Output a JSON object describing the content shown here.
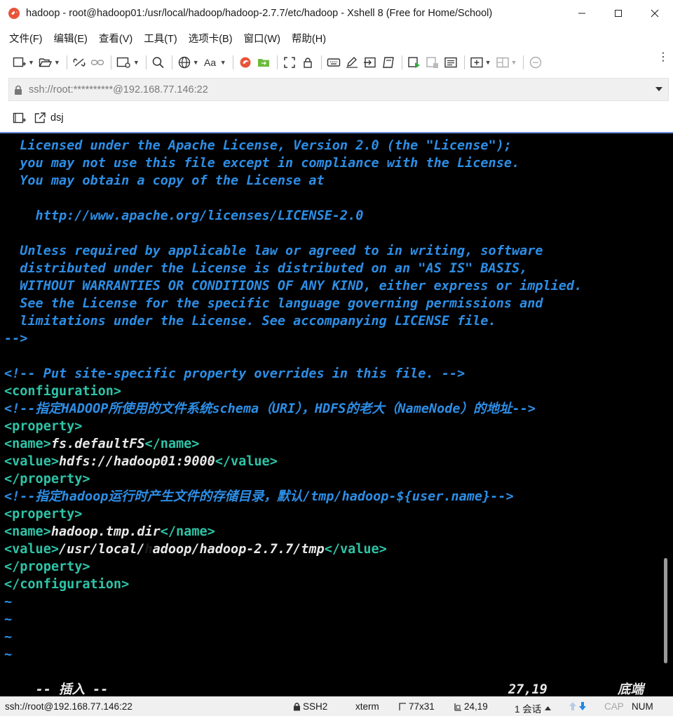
{
  "window": {
    "title": "hadoop - root@hadoop01:/usr/local/hadoop/hadoop-2.7.7/etc/hadoop - Xshell 8 (Free for Home/School)"
  },
  "menu": [
    "文件(F)",
    "编辑(E)",
    "查看(V)",
    "工具(T)",
    "选项卡(B)",
    "窗口(W)",
    "帮助(H)"
  ],
  "address": {
    "value": "ssh://root:**********@192.168.77.146:22"
  },
  "tab": {
    "label": "dsj"
  },
  "terminal": {
    "lines": [
      {
        "parts": [
          {
            "t": "  Licensed under the Apache License, Version 2.0 (the \"License\");",
            "c": "comment"
          }
        ]
      },
      {
        "parts": [
          {
            "t": "  you may not use this file except in compliance with the License.",
            "c": "comment"
          }
        ]
      },
      {
        "parts": [
          {
            "t": "  You may obtain a copy of the License at",
            "c": "comment"
          }
        ]
      },
      {
        "parts": [
          {
            "t": "",
            "c": "comment"
          }
        ]
      },
      {
        "parts": [
          {
            "t": "    http://www.apache.org/licenses/LICENSE-2.0",
            "c": "comment"
          }
        ]
      },
      {
        "parts": [
          {
            "t": "",
            "c": "comment"
          }
        ]
      },
      {
        "parts": [
          {
            "t": "  Unless required by applicable law or agreed to in writing, software",
            "c": "comment"
          }
        ]
      },
      {
        "parts": [
          {
            "t": "  distributed under the License is distributed on an \"AS IS\" BASIS,",
            "c": "comment"
          }
        ]
      },
      {
        "parts": [
          {
            "t": "  WITHOUT WARRANTIES OR CONDITIONS OF ANY KIND, either express or implied.",
            "c": "comment"
          }
        ]
      },
      {
        "parts": [
          {
            "t": "  See the License for the specific language governing permissions and",
            "c": "comment"
          }
        ]
      },
      {
        "parts": [
          {
            "t": "  limitations under the License. See accompanying LICENSE file.",
            "c": "comment"
          }
        ]
      },
      {
        "parts": [
          {
            "t": "-->",
            "c": "comment"
          }
        ]
      },
      {
        "parts": [
          {
            "t": "",
            "c": "comment"
          }
        ]
      },
      {
        "parts": [
          {
            "t": "<!-- Put site-specific property overrides in this file. -->",
            "c": "comment"
          }
        ]
      },
      {
        "parts": [
          {
            "t": "<configuration>",
            "c": "tag"
          }
        ]
      },
      {
        "parts": [
          {
            "t": "<!--指定HADOOP所使用的文件系统schema（URI），HDFS的老大（NameNode）的地址-->",
            "c": "comment"
          }
        ]
      },
      {
        "parts": [
          {
            "t": "<property>",
            "c": "tag"
          }
        ]
      },
      {
        "parts": [
          {
            "t": "<name>",
            "c": "tag"
          },
          {
            "t": "fs.defaultFS",
            "c": "text"
          },
          {
            "t": "</name>",
            "c": "tag"
          }
        ]
      },
      {
        "parts": [
          {
            "t": "<value>",
            "c": "tag"
          },
          {
            "t": "hdfs://hadoop01:9000",
            "c": "text"
          },
          {
            "t": "</value>",
            "c": "tag"
          }
        ]
      },
      {
        "parts": [
          {
            "t": "</property>",
            "c": "tag"
          }
        ]
      },
      {
        "parts": [
          {
            "t": "<!--指定hadoop运行时产生文件的存储目录，默认/tmp/hadoop-${user.name}-->",
            "c": "comment"
          }
        ]
      },
      {
        "parts": [
          {
            "t": "<property>",
            "c": "tag"
          }
        ]
      },
      {
        "parts": [
          {
            "t": "<name>",
            "c": "tag"
          },
          {
            "t": "hadoop.tmp.dir",
            "c": "text"
          },
          {
            "t": "</name>",
            "c": "tag"
          }
        ]
      },
      {
        "parts": [
          {
            "t": "<value>",
            "c": "tag"
          },
          {
            "t": "/usr/local/",
            "c": "text"
          },
          {
            "t": "h",
            "c": "cursor"
          },
          {
            "t": "adoop/hadoop-2.7.7/tmp",
            "c": "text"
          },
          {
            "t": "</value>",
            "c": "tag"
          }
        ]
      },
      {
        "parts": [
          {
            "t": "</property>",
            "c": "tag"
          }
        ]
      },
      {
        "parts": [
          {
            "t": "</configuration>",
            "c": "tag"
          }
        ]
      },
      {
        "parts": [
          {
            "t": "~",
            "c": "tilde"
          }
        ]
      },
      {
        "parts": [
          {
            "t": "~",
            "c": "tilde"
          }
        ]
      },
      {
        "parts": [
          {
            "t": "~",
            "c": "tilde"
          }
        ]
      },
      {
        "parts": [
          {
            "t": "~",
            "c": "tilde"
          }
        ]
      }
    ],
    "mode": "-- 插入 --",
    "position": "27,19",
    "scroll_label": "底端"
  },
  "statusbar": {
    "connection": "ssh://root@192.168.77.146:22",
    "protocol": "SSH2",
    "term": "xterm",
    "size": "77x31",
    "cursor": "24,19",
    "sessions": "1 会话",
    "cap": "CAP",
    "num": "NUM"
  },
  "colors": {
    "comment": "#2d8ee6",
    "tag": "#2ec4a8",
    "text": "#e8e8e8",
    "cursor": "#35e535",
    "background": "#000000"
  }
}
